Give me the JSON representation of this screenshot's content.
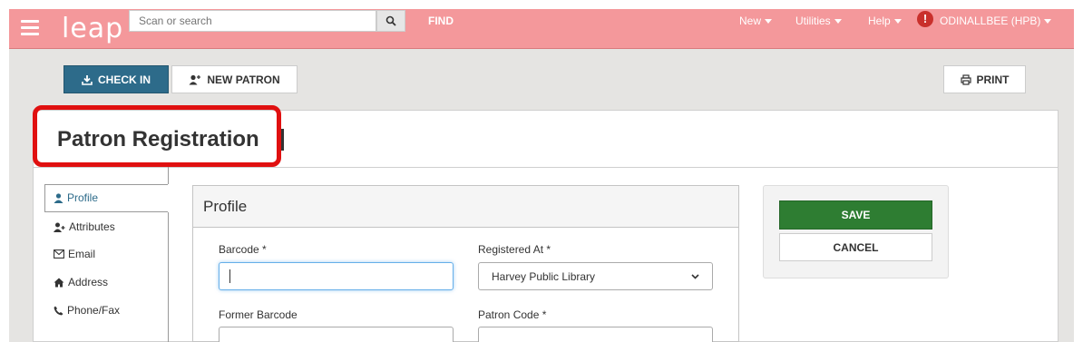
{
  "navbar": {
    "app_name": "leap",
    "search_placeholder": "Scan or search",
    "find_label": "FIND",
    "menus": [
      "New",
      "Utilities",
      "Help"
    ],
    "user_label": "ODINALLBEE (HPB)",
    "alert_icon": "!",
    "bg_color": "#f4989b"
  },
  "toolbar": {
    "checkin_label": "CHECK IN",
    "new_patron_label": "NEW PATRON",
    "print_label": "PRINT"
  },
  "page": {
    "title": "Patron Registration"
  },
  "tabs": [
    {
      "label": "Profile",
      "icon": "user-icon",
      "active": true
    },
    {
      "label": "Attributes",
      "icon": "user-plus-icon"
    },
    {
      "label": "Email",
      "icon": "envelope-icon"
    },
    {
      "label": "Address",
      "icon": "home-icon"
    },
    {
      "label": "Phone/Fax",
      "icon": "phone-icon"
    }
  ],
  "profile": {
    "heading": "Profile",
    "barcode_label": "Barcode *",
    "barcode_value": "",
    "registered_at_label": "Registered At *",
    "registered_at_value": "Harvey Public Library",
    "former_barcode_label": "Former Barcode",
    "patron_code_label": "Patron Code *"
  },
  "actions": {
    "save_label": "SAVE",
    "cancel_label": "CANCEL",
    "save_color": "#2e7d32"
  }
}
